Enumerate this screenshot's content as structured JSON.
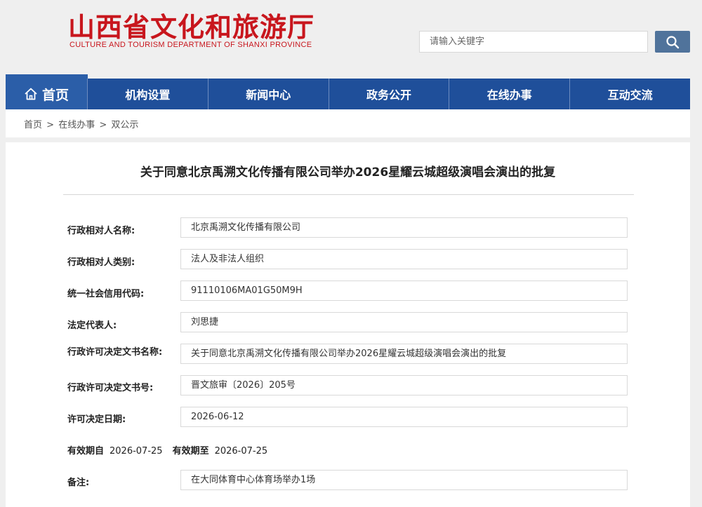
{
  "header": {
    "title": "山西省文化和旅游厅",
    "subtitle": "CULTURE AND TOURISM DEPARTMENT OF SHANXI PROVINCE",
    "brand_color": "#c8161d"
  },
  "search": {
    "placeholder": "请输入关键字",
    "button_icon": "search-icon"
  },
  "nav": {
    "home": {
      "label": "首页",
      "icon": "home-icon"
    },
    "items": [
      "机构设置",
      "新闻中心",
      "政务公开",
      "在线办事",
      "互动交流"
    ],
    "color": "#1f4f9a"
  },
  "breadcrumb": {
    "items": [
      "首页",
      "在线办事",
      "双公示"
    ],
    "separator": ">"
  },
  "article": {
    "title": "关于同意北京禹溯文化传播有限公司举办2026星耀云城超级演唱会演出的批复",
    "fields": [
      {
        "label": "行政相对人名称:",
        "value": "北京禹溯文化传播有限公司"
      },
      {
        "label": "行政相对人类别:",
        "value": "法人及非法人组织"
      },
      {
        "label": "统一社会信用代码:",
        "value": "91110106MA01G50M9H"
      },
      {
        "label": "法定代表人:",
        "value": "刘思捷"
      },
      {
        "label": "行政许可决定文书名称:",
        "value": "关于同意北京禹溯文化传播有限公司举办2026星耀云城超级演唱会演出的批复"
      },
      {
        "label": "行政许可决定文书号:",
        "value": "晋文旅审〔2026〕205号"
      },
      {
        "label": "许可决定日期:",
        "value": "2026-06-12"
      }
    ],
    "validity": {
      "from_label": "有效期自",
      "from_value": "2026-07-25",
      "to_label": "有效期至",
      "to_value": "2026-07-25"
    },
    "remark": {
      "label": "备注:",
      "value": "在大同体育中心体育场举办1场"
    }
  }
}
